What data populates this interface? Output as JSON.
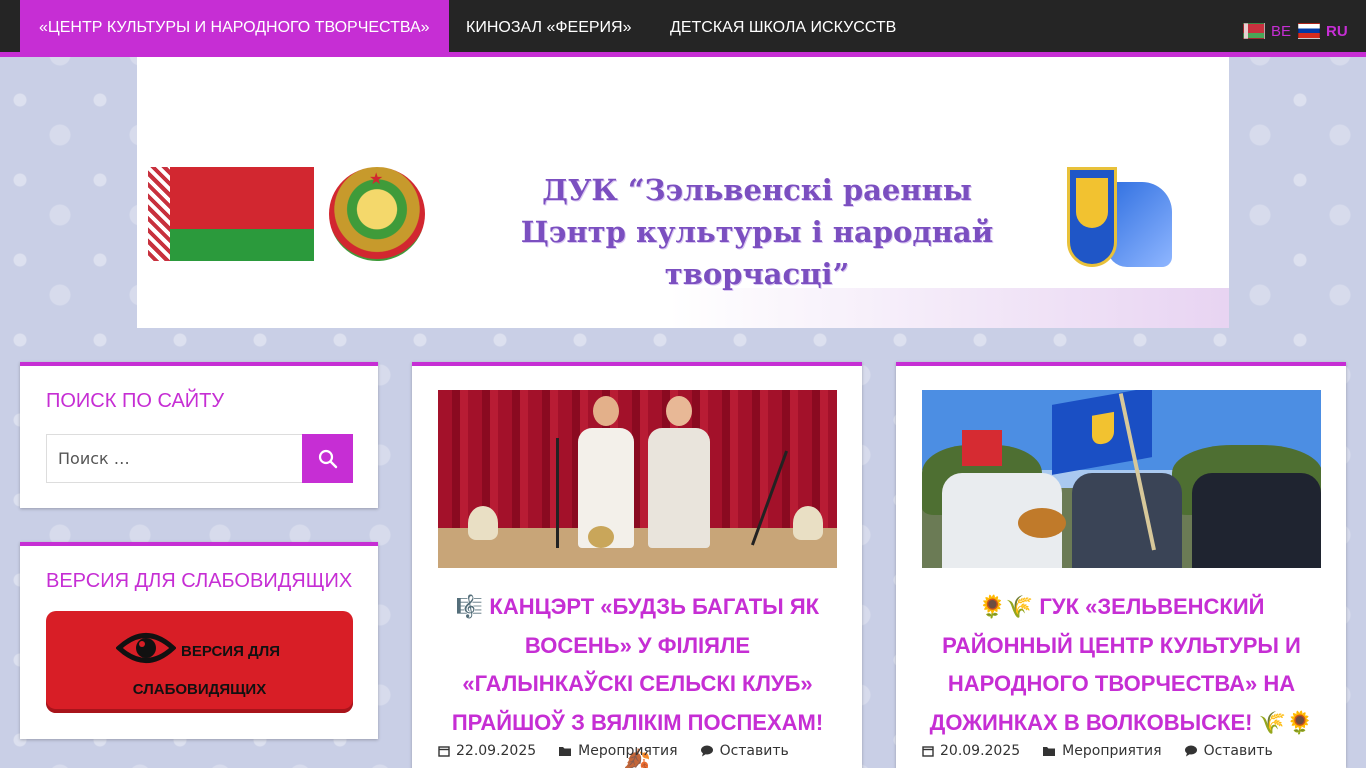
{
  "nav": {
    "items": [
      {
        "label": "«Центр культуры и народного творчества»",
        "active": true
      },
      {
        "label": "Кинозал «Феерия»",
        "active": false
      },
      {
        "label": "Детская школа искусств",
        "active": false
      }
    ],
    "languages": [
      {
        "code": "BE",
        "flag": "flag-by"
      },
      {
        "code": "RU",
        "flag": "flag-ru"
      }
    ]
  },
  "banner": {
    "title_line1": "ДУК “Зэльвенскі раенны",
    "title_line2": "Цэнтр культуры і народнай творчасці”"
  },
  "sidebar": {
    "search": {
      "heading": "Поиск по сайту",
      "placeholder": "Поиск …"
    },
    "accessibility": {
      "heading": "Версия для слабовидящих",
      "button_line1": "ВЕРСИЯ ДЛЯ",
      "button_line2": "СЛАБОВИДЯЩИХ"
    }
  },
  "posts": [
    {
      "title": "🎼 Канцэрт «Будзь багаты як восень» у філіяле «Галынкаўскі сельскі клуб» прайшоў з вялікім поспехам! 🍂",
      "date": "22.09.2025",
      "category": "Мероприятия",
      "comment": "Оставить"
    },
    {
      "title": "🌻🌾 ГУК «Зельвенский районный центр культуры и народного творчества» на Дожинках в Волковыске! 🌾🌻",
      "date": "20.09.2025",
      "category": "Мероприятия",
      "comment": "Оставить"
    }
  ],
  "colors": {
    "accent": "#c62ed4",
    "nav_bg": "#252525",
    "vi_button": "#d81e26"
  }
}
